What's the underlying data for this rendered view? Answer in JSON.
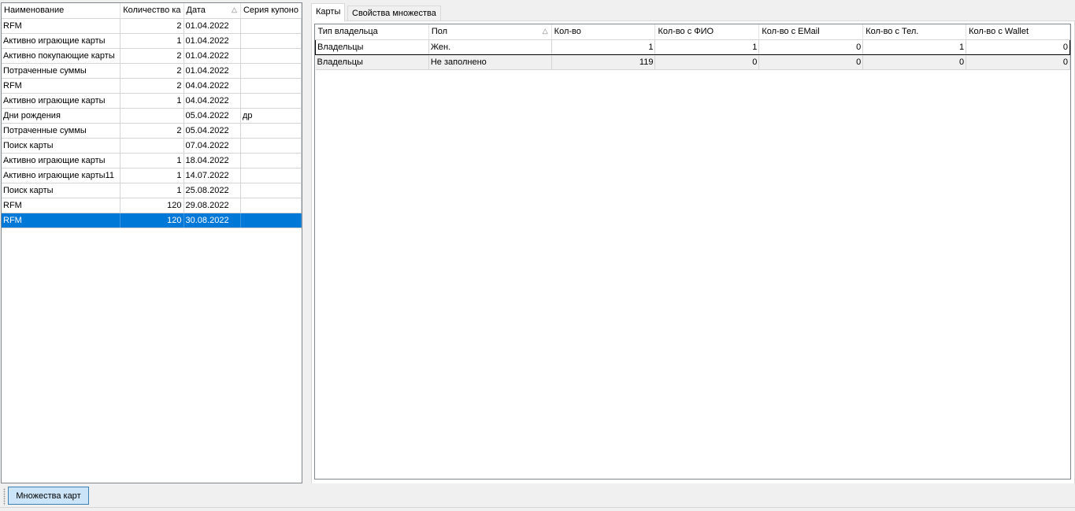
{
  "left_grid": {
    "columns": [
      "Наименование",
      "Количество ка",
      "Дата",
      "Серия купоно"
    ],
    "sort_column_index": 2,
    "rows": [
      {
        "name": "RFM",
        "count": "2",
        "date": "01.04.2022",
        "series": ""
      },
      {
        "name": "Активно играющие карты",
        "count": "1",
        "date": "01.04.2022",
        "series": ""
      },
      {
        "name": "Активно покупающие карты",
        "count": "2",
        "date": "01.04.2022",
        "series": ""
      },
      {
        "name": "Потраченные суммы",
        "count": "2",
        "date": "01.04.2022",
        "series": ""
      },
      {
        "name": "RFM",
        "count": "2",
        "date": "04.04.2022",
        "series": ""
      },
      {
        "name": "Активно играющие карты",
        "count": "1",
        "date": "04.04.2022",
        "series": ""
      },
      {
        "name": "Дни рождения",
        "count": "",
        "date": "05.04.2022",
        "series": "др"
      },
      {
        "name": "Потраченные суммы",
        "count": "2",
        "date": "05.04.2022",
        "series": ""
      },
      {
        "name": "Поиск карты",
        "count": "",
        "date": "07.04.2022",
        "series": ""
      },
      {
        "name": "Активно играющие карты",
        "count": "1",
        "date": "18.04.2022",
        "series": ""
      },
      {
        "name": "Активно играющие карты11",
        "count": "1",
        "date": "14.07.2022",
        "series": ""
      },
      {
        "name": "Поиск карты",
        "count": "1",
        "date": "25.08.2022",
        "series": ""
      },
      {
        "name": "RFM",
        "count": "120",
        "date": "29.08.2022",
        "series": ""
      },
      {
        "name": "RFM",
        "count": "120",
        "date": "30.08.2022",
        "series": ""
      }
    ],
    "selected_row_index": 13
  },
  "tabs": [
    {
      "label": "Карты",
      "active": true
    },
    {
      "label": "Свойства множества",
      "active": false
    }
  ],
  "right_grid": {
    "columns": [
      "Тип владельца",
      "Пол",
      "Кол-во",
      "Кол-во с ФИО",
      "Кол-во с EMail",
      "Кол-во с Тел.",
      "Кол-во с Wallet"
    ],
    "sort_column_index": 1,
    "rows": [
      {
        "owner_type": "Владельцы",
        "gender": "Жен.",
        "count": "1",
        "with_fio": "1",
        "with_email": "0",
        "with_phone": "1",
        "with_wallet": "0"
      },
      {
        "owner_type": "Владельцы",
        "gender": "Не заполнено",
        "count": "119",
        "with_fio": "0",
        "with_email": "0",
        "with_phone": "0",
        "with_wallet": "0"
      }
    ]
  },
  "bottom": {
    "sets_button_label": "Множества карт"
  },
  "icons": {
    "sort_indicator": "sort-ascending-icon"
  },
  "colors": {
    "selection": "#0078d7",
    "button_bg": "#cce4f7"
  }
}
